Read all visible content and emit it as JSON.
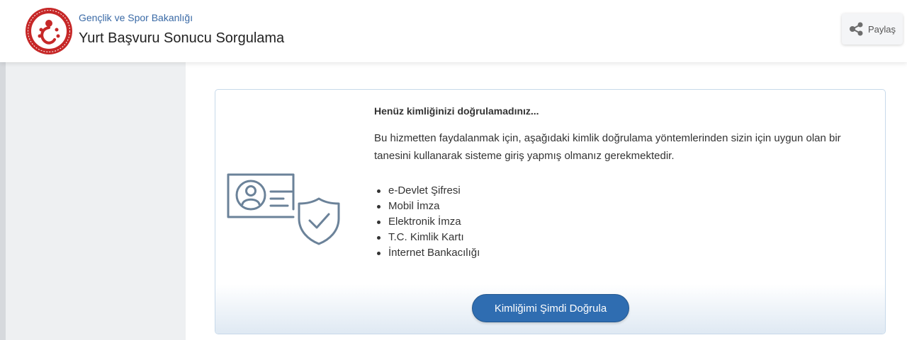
{
  "header": {
    "ministry": "Gençlik ve Spor Bakanlığı",
    "service_title": "Yurt Başvuru Sonucu Sorgulama",
    "share_label": "Paylaş",
    "logo_icon": "ministry-emblem-icon",
    "share_icon": "share-icon"
  },
  "notice": {
    "heading": "Henüz kimliğinizi doğrulamadınız...",
    "description": "Bu hizmetten faydalanmak için, aşağıdaki kimlik doğrulama yöntemlerinden sizin için uygun olan bir tanesini kullanarak sisteme giriş yapmış olmanız gerekmektedir.",
    "methods": [
      "e-Devlet Şifresi",
      "Mobil İmza",
      "Elektronik İmza",
      "T.C. Kimlik Kartı",
      "İnternet Bankacılığı"
    ],
    "illustration_icon": "id-card-shield-icon",
    "button_label": "Kimliğimi Şimdi Doğrula"
  },
  "colors": {
    "accent": "#2f6db1",
    "brand_red": "#c62828",
    "link": "#3a6aa6",
    "illustration": "#6b8299"
  }
}
